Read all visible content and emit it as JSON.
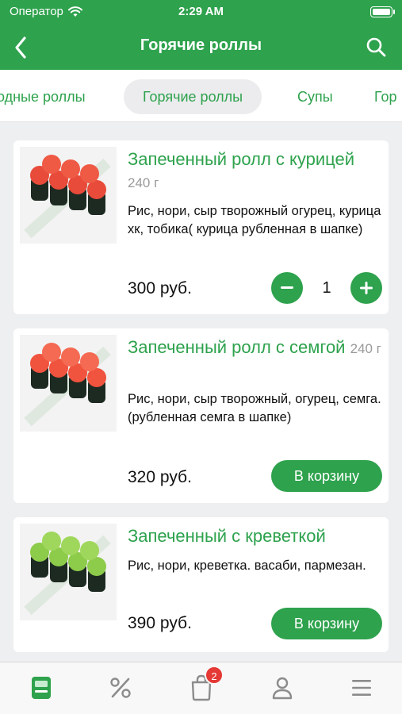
{
  "status_bar": {
    "carrier": "Оператор",
    "time": "2:29 AM"
  },
  "nav": {
    "title": "Горячие роллы"
  },
  "categories": [
    "одные роллы",
    "Горячие роллы",
    "Супы",
    "Гор"
  ],
  "active_category": "Горячие роллы",
  "products": [
    {
      "name": "Запеченный ролл с курицей",
      "weight": "240 г",
      "description": "Рис, нори, сыр творожный огурец, курица хк, тобика( курица рубленная в шапке)",
      "price": "300 руб.",
      "quantity": "1",
      "in_cart": true
    },
    {
      "name": "Запеченный ролл с семгой",
      "weight": "240 г",
      "description": "Рис, нори, сыр творожный, огурец, семга.(рубленная семга в шапке)",
      "price": "320 руб.",
      "cart_label": "В корзину",
      "in_cart": false
    },
    {
      "name": "Запеченный с креветкой",
      "weight": "",
      "description": "Рис, нори, креветка. васаби, пармезан.",
      "price": "390 руб.",
      "cart_label": "В корзину",
      "in_cart": false
    }
  ],
  "tabbar": {
    "cart_badge": "2"
  },
  "colors": {
    "accent": "#2ea24d",
    "badge": "#e53935"
  }
}
